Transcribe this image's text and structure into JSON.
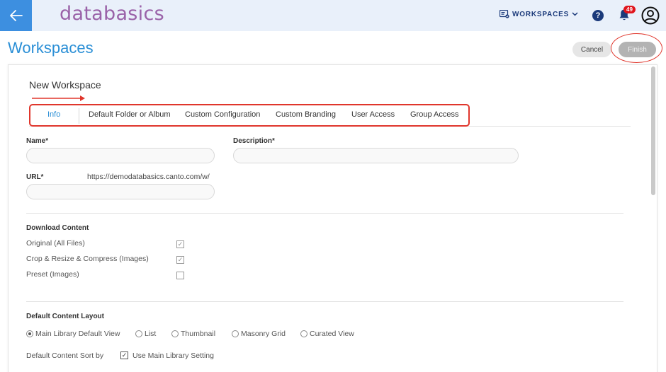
{
  "header": {
    "logo_text": "databasics",
    "workspaces_label": "WORKSPACES",
    "help_label": "?",
    "notification_count": "49",
    "icons": {
      "back": "arrow-left-icon",
      "workspaces": "workspace-icon",
      "dropdown": "chevron-down-icon",
      "help": "help-icon",
      "bell": "bell-icon",
      "user": "user-avatar-icon"
    }
  },
  "page": {
    "title": "Workspaces",
    "cancel_label": "Cancel",
    "finish_label": "Finish"
  },
  "form": {
    "section_title": "New Workspace",
    "tabs": [
      {
        "label": "Info",
        "active": true
      },
      {
        "label": "Default Folder or Album",
        "active": false
      },
      {
        "label": "Custom Configuration",
        "active": false
      },
      {
        "label": "Custom Branding",
        "active": false
      },
      {
        "label": "User Access",
        "active": false
      },
      {
        "label": "Group Access",
        "active": false
      }
    ],
    "name_label": "Name*",
    "name_value": "",
    "description_label": "Description*",
    "description_value": "",
    "url_label": "URL*",
    "url_prefix": "https://demodatabasics.canto.com/w/",
    "url_value": ""
  },
  "download": {
    "title": "Download Content",
    "options": [
      {
        "label": "Original (All Files)",
        "checked": true
      },
      {
        "label": "Crop & Resize & Compress (Images)",
        "checked": true
      },
      {
        "label": "Preset (Images)",
        "checked": false
      }
    ]
  },
  "layout": {
    "title": "Default Content Layout",
    "options": [
      {
        "label": "Main Library Default View",
        "selected": true
      },
      {
        "label": "List",
        "selected": false
      },
      {
        "label": "Thumbnail",
        "selected": false
      },
      {
        "label": "Masonry Grid",
        "selected": false
      },
      {
        "label": "Curated View",
        "selected": false
      }
    ],
    "sort_label": "Default Content Sort by",
    "sort_option_label": "Use Main Library Setting",
    "sort_option_checked": true
  },
  "colors": {
    "accent_blue": "#2b8fd6",
    "back_button": "#3d8fe0",
    "logo": "#9a62a8",
    "navy": "#1b3a7a",
    "annotation_red": "#e0362c",
    "badge_red": "#e0141c"
  }
}
